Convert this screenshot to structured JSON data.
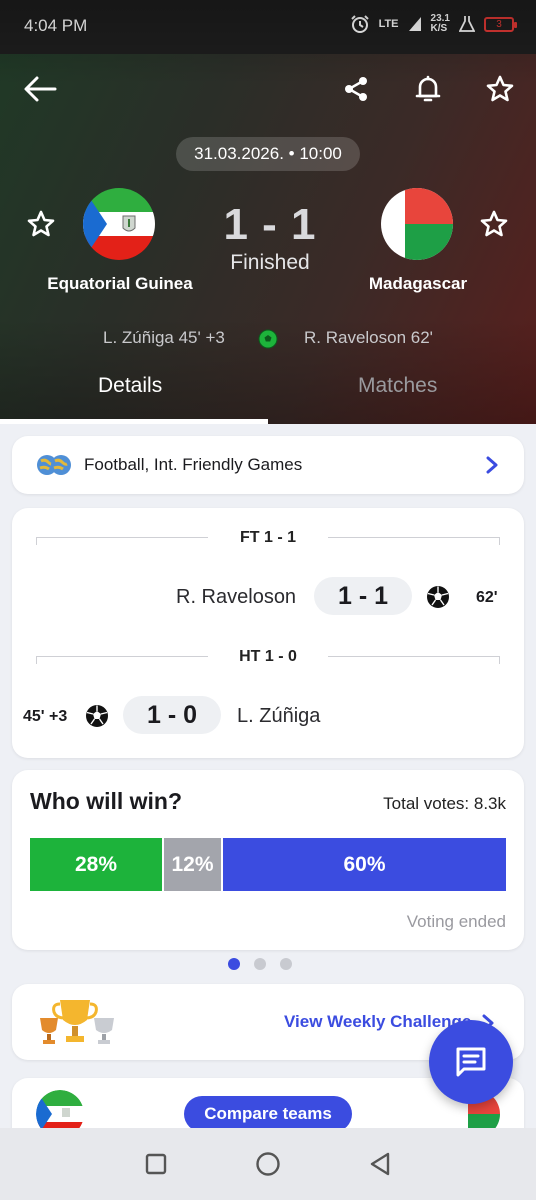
{
  "status_bar": {
    "time": "4:04 PM",
    "network": "LTE",
    "speed": "23.1",
    "speed_unit": "K/S",
    "battery": "3"
  },
  "match": {
    "datetime": "31.03.2026. • 10:00",
    "home": {
      "name": "Equatorial Guinea",
      "scorer": "L. Zúñiga 45' +3"
    },
    "away": {
      "name": "Madagascar",
      "scorer": "R. Raveloson 62'"
    },
    "score": "1 - 1",
    "status": "Finished"
  },
  "tabs": [
    {
      "label": "Details",
      "active": true
    },
    {
      "label": "Matches",
      "active": false
    }
  ],
  "competition": {
    "label": "Football, Int. Friendly Games"
  },
  "timeline": {
    "ft_label": "FT 1 - 1",
    "ht_label": "HT 1 - 0",
    "events": [
      {
        "player": "R. Raveloson",
        "score": "1 - 1",
        "minute": "62'",
        "side": "away"
      },
      {
        "player": "L. Zúñiga",
        "score": "1 - 0",
        "minute": "45' +3",
        "side": "home"
      }
    ]
  },
  "poll": {
    "title": "Who will win?",
    "total_votes": "Total votes: 8.3k",
    "home_pct": "28%",
    "draw_pct": "12%",
    "away_pct": "60%",
    "home_share": 28,
    "draw_share": 12,
    "away_share": 60,
    "status": "Voting ended",
    "colors": {
      "home": "#1db33b",
      "draw": "#a3a5ac",
      "away": "#3b4ce0"
    }
  },
  "carousel": {
    "pages": 3,
    "active": 1
  },
  "challenge": {
    "link": "View Weekly Challenge"
  },
  "compare": {
    "button": "Compare teams"
  },
  "colors": {
    "accent": "#3b4ce0",
    "goal_green": "#1db33b"
  }
}
